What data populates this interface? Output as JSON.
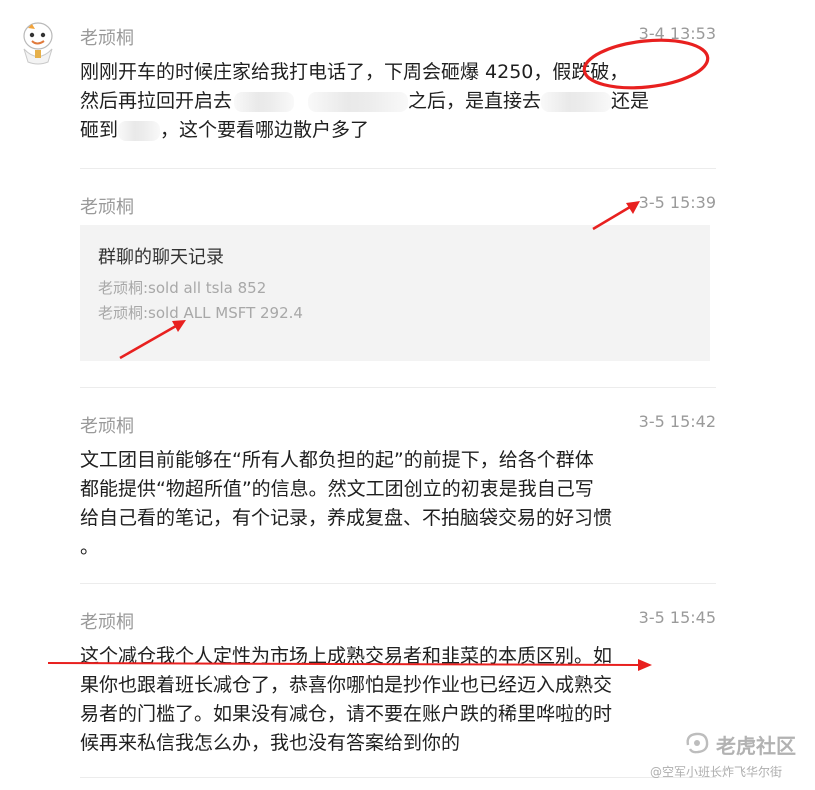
{
  "avatar": {
    "icon": "cartoon-avatar-icon"
  },
  "messages": [
    {
      "sender": "老顽桐",
      "time": "3-4 13:53",
      "line1": "刚刚开车的时候庄家给我打电话了，下周会砸爆 4250，假跌破，",
      "line2_a": "然后再拉回开启去",
      "line2_b": "之后，是直接去",
      "line2_c": "还是",
      "line3_a": "砸到",
      "line3_b": "，这个要看哪边散户多了"
    },
    {
      "sender": "老顽桐",
      "time": "3-5 15:39",
      "card": {
        "title": "群聊的聊天记录",
        "line1": "老顽桐:sold all tsla 852",
        "line2": "老顽桐:sold ALL MSFT 292.4"
      }
    },
    {
      "sender": "老顽桐",
      "time": "3-5 15:42",
      "lines": [
        "文工团目前能够在“所有人都负担的起”的前提下，给各个群体",
        "都能提供“物超所值”的信息。然文工团创立的初衷是我自己写",
        "给自己看的笔记，有个记录，养成复盘、不拍脑袋交易的好习惯",
        "。"
      ]
    },
    {
      "sender": "老顽桐",
      "time": "3-5 15:45",
      "lines": [
        "这个减仓我个人定性为市场上成熟交易者和韭菜的本质区别。如",
        "果你也跟着班长减仓了，恭喜你哪怕是抄作业也已经迈入成熟交",
        "易者的门槛了。如果没有减仓，请不要在账户跌的稀里哗啦的时",
        "候再来私信我怎么办，我也没有答案给到你的"
      ]
    }
  ],
  "watermark": {
    "brand": "老虎社区",
    "sub": "@空军小班长炸飞华尔街",
    "icon": "tiger-community-logo-icon"
  },
  "colors": {
    "annotation_red": "#e8201f",
    "muted_text": "#9a9a9a",
    "card_bg": "#f3f3f3"
  }
}
